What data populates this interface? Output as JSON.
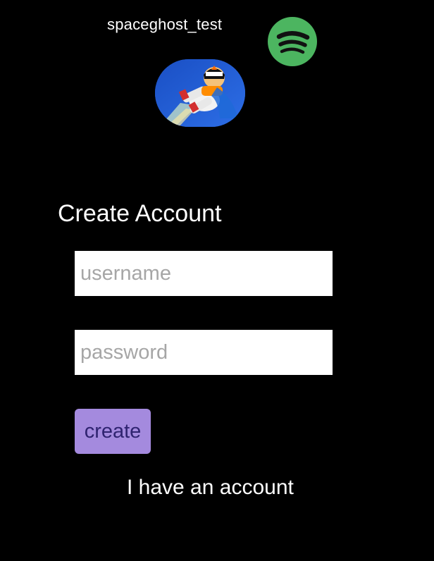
{
  "header": {
    "username": "spaceghost_test",
    "logo_icon": "spotify-icon",
    "avatar_icon": "user-avatar"
  },
  "form": {
    "heading": "Create Account",
    "username_placeholder": "username",
    "username_value": "",
    "password_placeholder": "password",
    "password_value": "",
    "create_label": "create",
    "have_account_label": "I have an account"
  },
  "colors": {
    "background": "#000000",
    "spotify_green": "#4cb560",
    "button_background": "#a48ade",
    "button_text": "#2f2370",
    "input_background": "#ffffff",
    "placeholder": "#a6a6a6"
  }
}
